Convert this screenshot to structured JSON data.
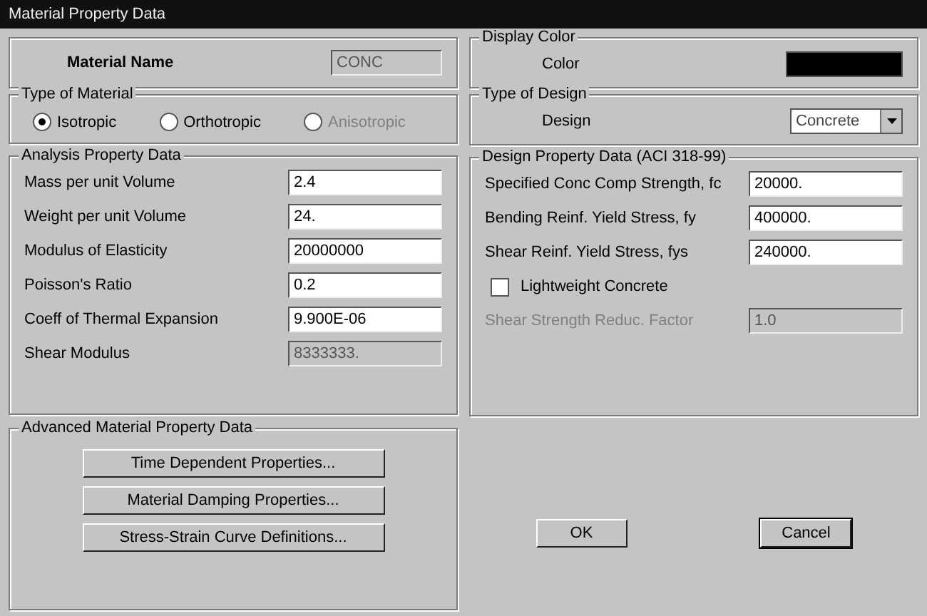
{
  "window": {
    "title": "Material Property Data"
  },
  "material_name": {
    "label": "Material Name",
    "value": "CONC"
  },
  "type_of_material": {
    "title": "Type of Material",
    "options": [
      {
        "label": "Isotropic",
        "selected": true,
        "disabled": false
      },
      {
        "label": "Orthotropic",
        "selected": false,
        "disabled": false
      },
      {
        "label": "Anisotropic",
        "selected": false,
        "disabled": true
      }
    ]
  },
  "display_color": {
    "title": "Display Color",
    "label": "Color",
    "color": "#000000"
  },
  "type_of_design": {
    "title": "Type of Design",
    "label": "Design",
    "value": "Concrete"
  },
  "analysis_property_data": {
    "title": "Analysis Property Data",
    "rows": [
      {
        "label": "Mass per unit Volume",
        "value": "2.4",
        "disabled": false
      },
      {
        "label": "Weight per unit Volume",
        "value": "24.",
        "disabled": false
      },
      {
        "label": "Modulus of Elasticity",
        "value": "20000000",
        "disabled": false
      },
      {
        "label": "Poisson's Ratio",
        "value": "0.2",
        "disabled": false
      },
      {
        "label": "Coeff of Thermal Expansion",
        "value": "9.900E-06",
        "disabled": false
      },
      {
        "label": "Shear Modulus",
        "value": "8333333.",
        "disabled": true
      }
    ]
  },
  "design_property_data": {
    "title": "Design Property Data (ACI 318-99)",
    "rows": [
      {
        "label": "Specified Conc Comp Strength, fc",
        "value": "20000.",
        "disabled": false
      },
      {
        "label": "Bending Reinf. Yield Stress, fy",
        "value": "400000.",
        "disabled": false
      },
      {
        "label": "Shear Reinf. Yield Stress, fys",
        "value": "240000.",
        "disabled": false
      }
    ],
    "lightweight": {
      "label": "Lightweight Concrete",
      "checked": false
    },
    "reduction": {
      "label": "Shear Strength Reduc. Factor",
      "value": "1.0",
      "disabled": true
    }
  },
  "advanced": {
    "title": "Advanced Material Property Data",
    "buttons": [
      "Time Dependent Properties...",
      "Material Damping Properties...",
      "Stress-Strain Curve Definitions..."
    ]
  },
  "buttons": [
    {
      "label": "OK",
      "kind": "ok"
    },
    {
      "label": "Cancel",
      "kind": "cancel"
    }
  ]
}
